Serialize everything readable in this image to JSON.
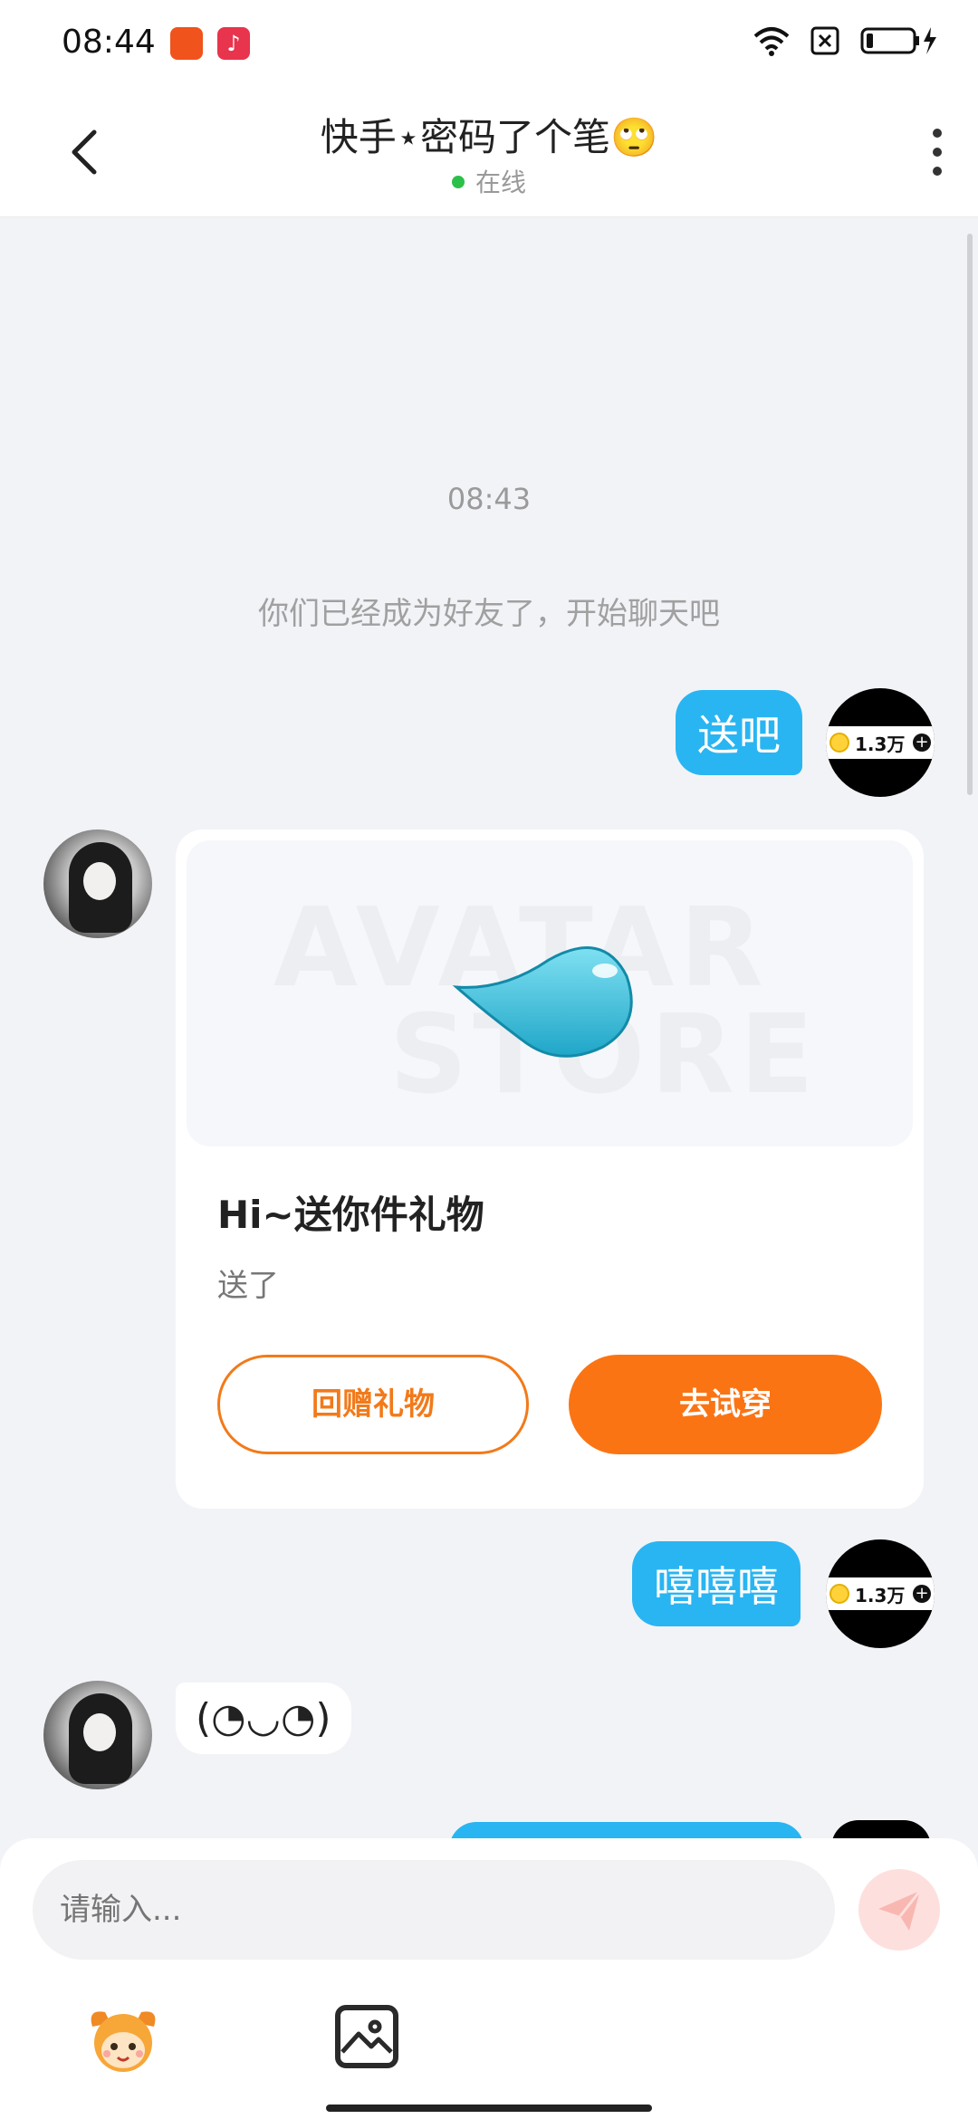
{
  "status_bar": {
    "time": "08:44",
    "battery_icon": "battery-charging-icon",
    "wifi_icon": "wifi-icon"
  },
  "header": {
    "title": "快手⋆密码了个笔🙄",
    "status": "在线"
  },
  "chat": {
    "timestamp": "08:43",
    "system_message": "你们已经成为好友了，开始聊天吧",
    "messages": [
      {
        "from": "me",
        "text": "送吧"
      },
      {
        "from": "me",
        "text": "嘻嘻嘻"
      },
      {
        "from": "other",
        "text": "(◔◡◔)"
      }
    ],
    "self_badge": "1.3万",
    "gift_card": {
      "watermark_top": "AVATAR",
      "watermark_bottom": "STORE",
      "title": "Hi~送你件礼物",
      "subtitle": "送了",
      "return_gift_label": "回赠礼物",
      "try_on_label": "去试穿"
    }
  },
  "input": {
    "placeholder": "请输入..."
  },
  "colors": {
    "accent_blue": "#29b5f2",
    "accent_orange": "#fb7414",
    "online_green": "#2bc04a"
  }
}
